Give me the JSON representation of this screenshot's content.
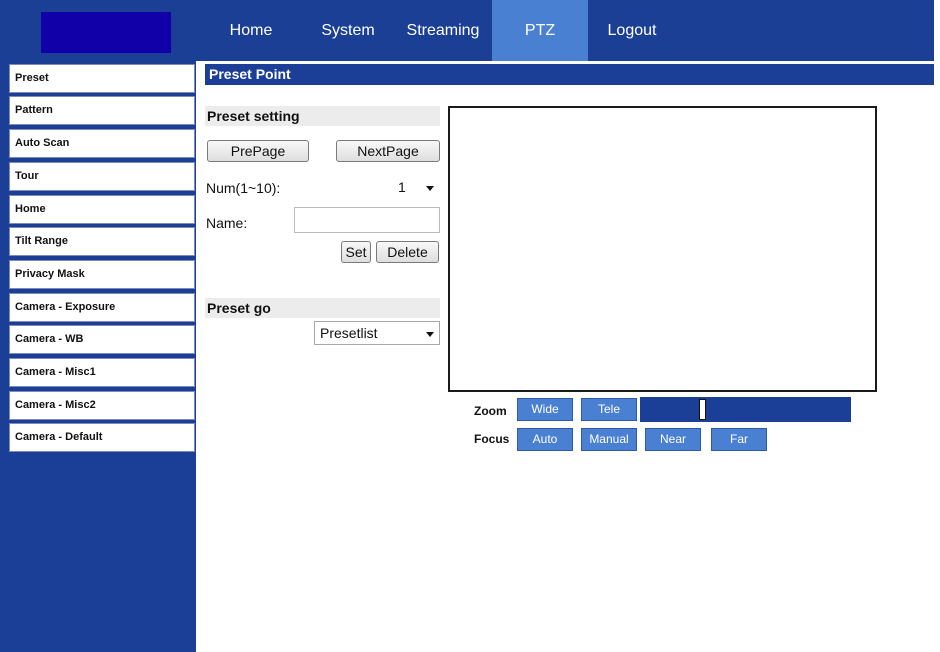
{
  "nav": {
    "items": [
      {
        "label": "Home"
      },
      {
        "label": "System"
      },
      {
        "label": "Streaming"
      },
      {
        "label": "PTZ",
        "active": true
      },
      {
        "label": "Logout"
      }
    ]
  },
  "sidebar": {
    "items": [
      {
        "label": "Preset"
      },
      {
        "label": "Pattern"
      },
      {
        "label": "Auto Scan"
      },
      {
        "label": "Tour"
      },
      {
        "label": "Home"
      },
      {
        "label": "Tilt Range"
      },
      {
        "label": "Privacy Mask"
      },
      {
        "label": "Camera - Exposure"
      },
      {
        "label": "Camera - WB"
      },
      {
        "label": "Camera - Misc1"
      },
      {
        "label": "Camera - Misc2"
      },
      {
        "label": "Camera - Default"
      }
    ]
  },
  "main": {
    "title": "Preset Point",
    "preset_setting": {
      "header": "Preset setting",
      "prepage_label": "PrePage",
      "nextpage_label": "NextPage",
      "num_label": "Num(1~10):",
      "num_value": "1",
      "name_label": "Name:",
      "name_value": "",
      "set_label": "Set",
      "delete_label": "Delete"
    },
    "preset_go": {
      "header": "Preset go",
      "select_value": "Presetlist"
    }
  },
  "controls": {
    "zoom_label": "Zoom",
    "wide_label": "Wide",
    "tele_label": "Tele",
    "zoom_level": 0.29,
    "focus_label": "Focus",
    "auto_label": "Auto",
    "manual_label": "Manual",
    "near_label": "Near",
    "far_label": "Far"
  },
  "colors": {
    "brand_blue": "#1b3f96",
    "accent_blue": "#4a80d2",
    "logo_blue": "#1100a8"
  }
}
